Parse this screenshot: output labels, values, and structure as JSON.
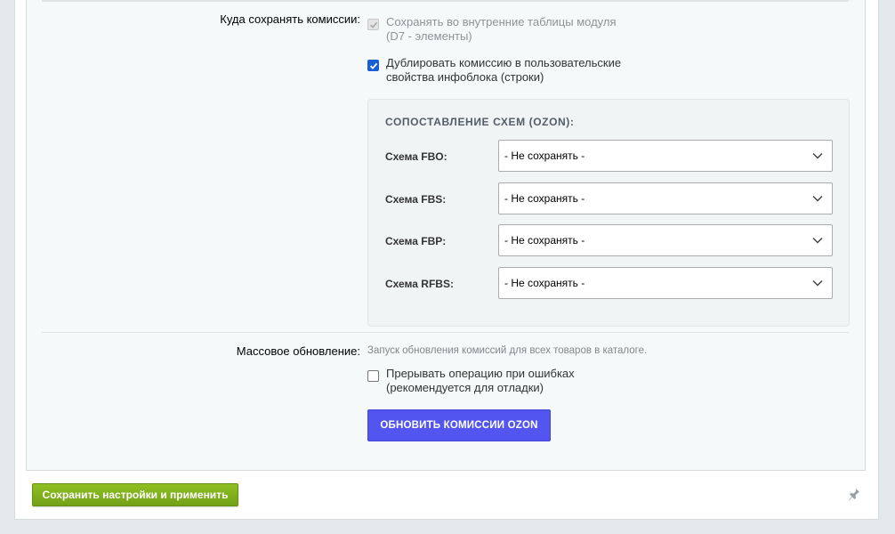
{
  "commission": {
    "where_label": "Куда сохранять комиссии:",
    "option_internal": "Сохранять во внутренние таблицы модуля (D7 - элементы)",
    "option_duplicate": "Дублировать комиссию в пользовательские свойства инфоблока (строки)",
    "option_internal_checked": true,
    "option_internal_disabled": true,
    "option_duplicate_checked": true
  },
  "schemes": {
    "title": "СОПОСТАВЛЕНИЕ СХЕМ (OZON):",
    "items": [
      {
        "label": "Схема FBO:",
        "value": "- Не сохранять -"
      },
      {
        "label": "Схема FBS:",
        "value": "- Не сохранять -"
      },
      {
        "label": "Схема FBP:",
        "value": "- Не сохранять -"
      },
      {
        "label": "Схема RFBS:",
        "value": "- Не сохранять -"
      }
    ]
  },
  "mass_update": {
    "label": "Массовое обновление:",
    "hint": "Запуск обновления комиссий для всех товаров в каталоге.",
    "abort_option": "Прерывать операцию при ошибках (рекомендуется для отладки)",
    "abort_checked": false,
    "button_label": "ОБНОВИТЬ КОМИССИИ OZON"
  },
  "footer": {
    "save_label": "Сохранить настройки и применить"
  },
  "icons": {
    "chevron": "chevron-down-icon",
    "check": "check-icon",
    "pin": "pin-icon"
  },
  "colors": {
    "update_button": "#5355f0",
    "save_button": "#7aab1a",
    "checkbox_checked": "#1a5fd1"
  }
}
